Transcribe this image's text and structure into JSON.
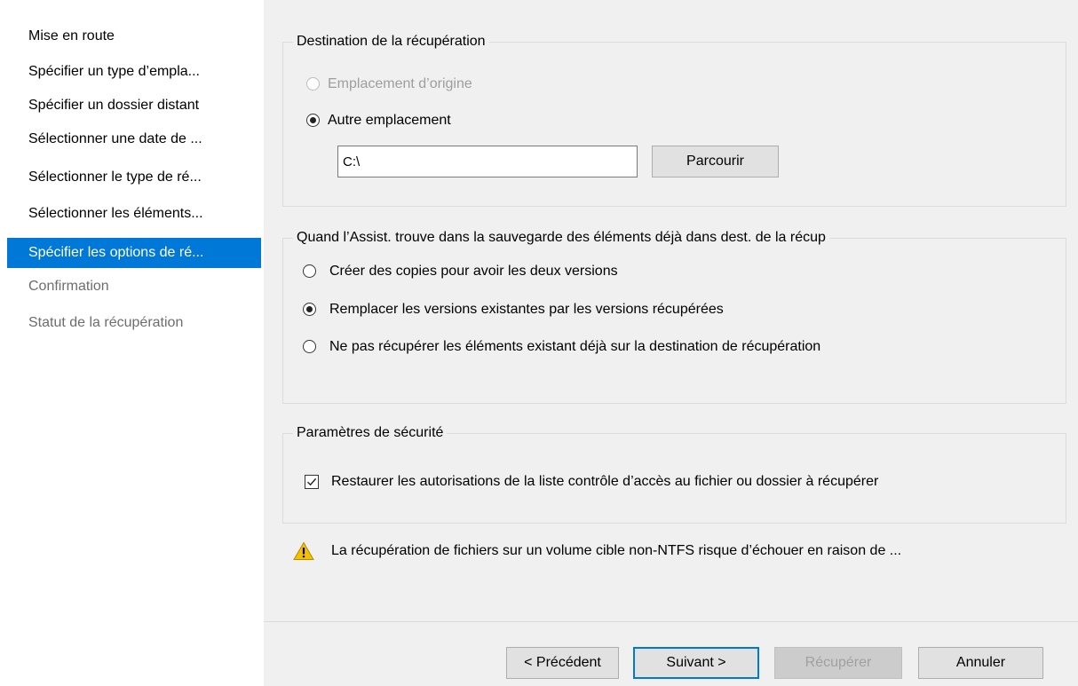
{
  "sidebar": {
    "items": [
      {
        "label": "Mise en route",
        "state": "normal"
      },
      {
        "label": "Spécifier un type d’empla...",
        "state": "normal"
      },
      {
        "label": "Spécifier un dossier distant",
        "state": "normal"
      },
      {
        "label": "Sélectionner une date de ...",
        "state": "normal"
      },
      {
        "label": "Sélectionner le type de ré...",
        "state": "normal"
      },
      {
        "label": "Sélectionner les éléments...",
        "state": "normal"
      },
      {
        "label": "Spécifier les options de ré...",
        "state": "active"
      },
      {
        "label": "Confirmation",
        "state": "disabled"
      },
      {
        "label": "Statut de la récupération",
        "state": "disabled"
      }
    ]
  },
  "destination": {
    "title": "Destination de la récupération",
    "original_label": "Emplacement d’origine",
    "other_label": "Autre emplacement",
    "path_value": "C:\\",
    "browse_label": "Parcourir"
  },
  "conflict": {
    "title": "Quand l’Assist. trouve dans la sauvegarde des éléments déjà dans dest. de la récup",
    "options": [
      {
        "label": "Créer des copies pour avoir les deux versions",
        "checked": false
      },
      {
        "label": "Remplacer les versions existantes par les versions récupérées",
        "checked": true
      },
      {
        "label": "Ne pas récupérer les éléments existant déjà sur la destination de récupération",
        "checked": false
      }
    ]
  },
  "security": {
    "title": "Paramètres de sécurité",
    "restore_acl_label": "Restaurer les autorisations de la liste contrôle d’accès au fichier ou dossier à récupérer",
    "restore_acl_checked": true
  },
  "warning": {
    "icon": "warning-icon",
    "text": "La récupération de fichiers sur un volume cible non-NTFS risque d’échouer en raison de ..."
  },
  "footer": {
    "previous_label": "< Précédent",
    "next_label": "Suivant >",
    "recover_label": "Récupérer",
    "cancel_label": "Annuler"
  },
  "colors": {
    "accent": "#0078d7",
    "warning": "#f5c000"
  }
}
